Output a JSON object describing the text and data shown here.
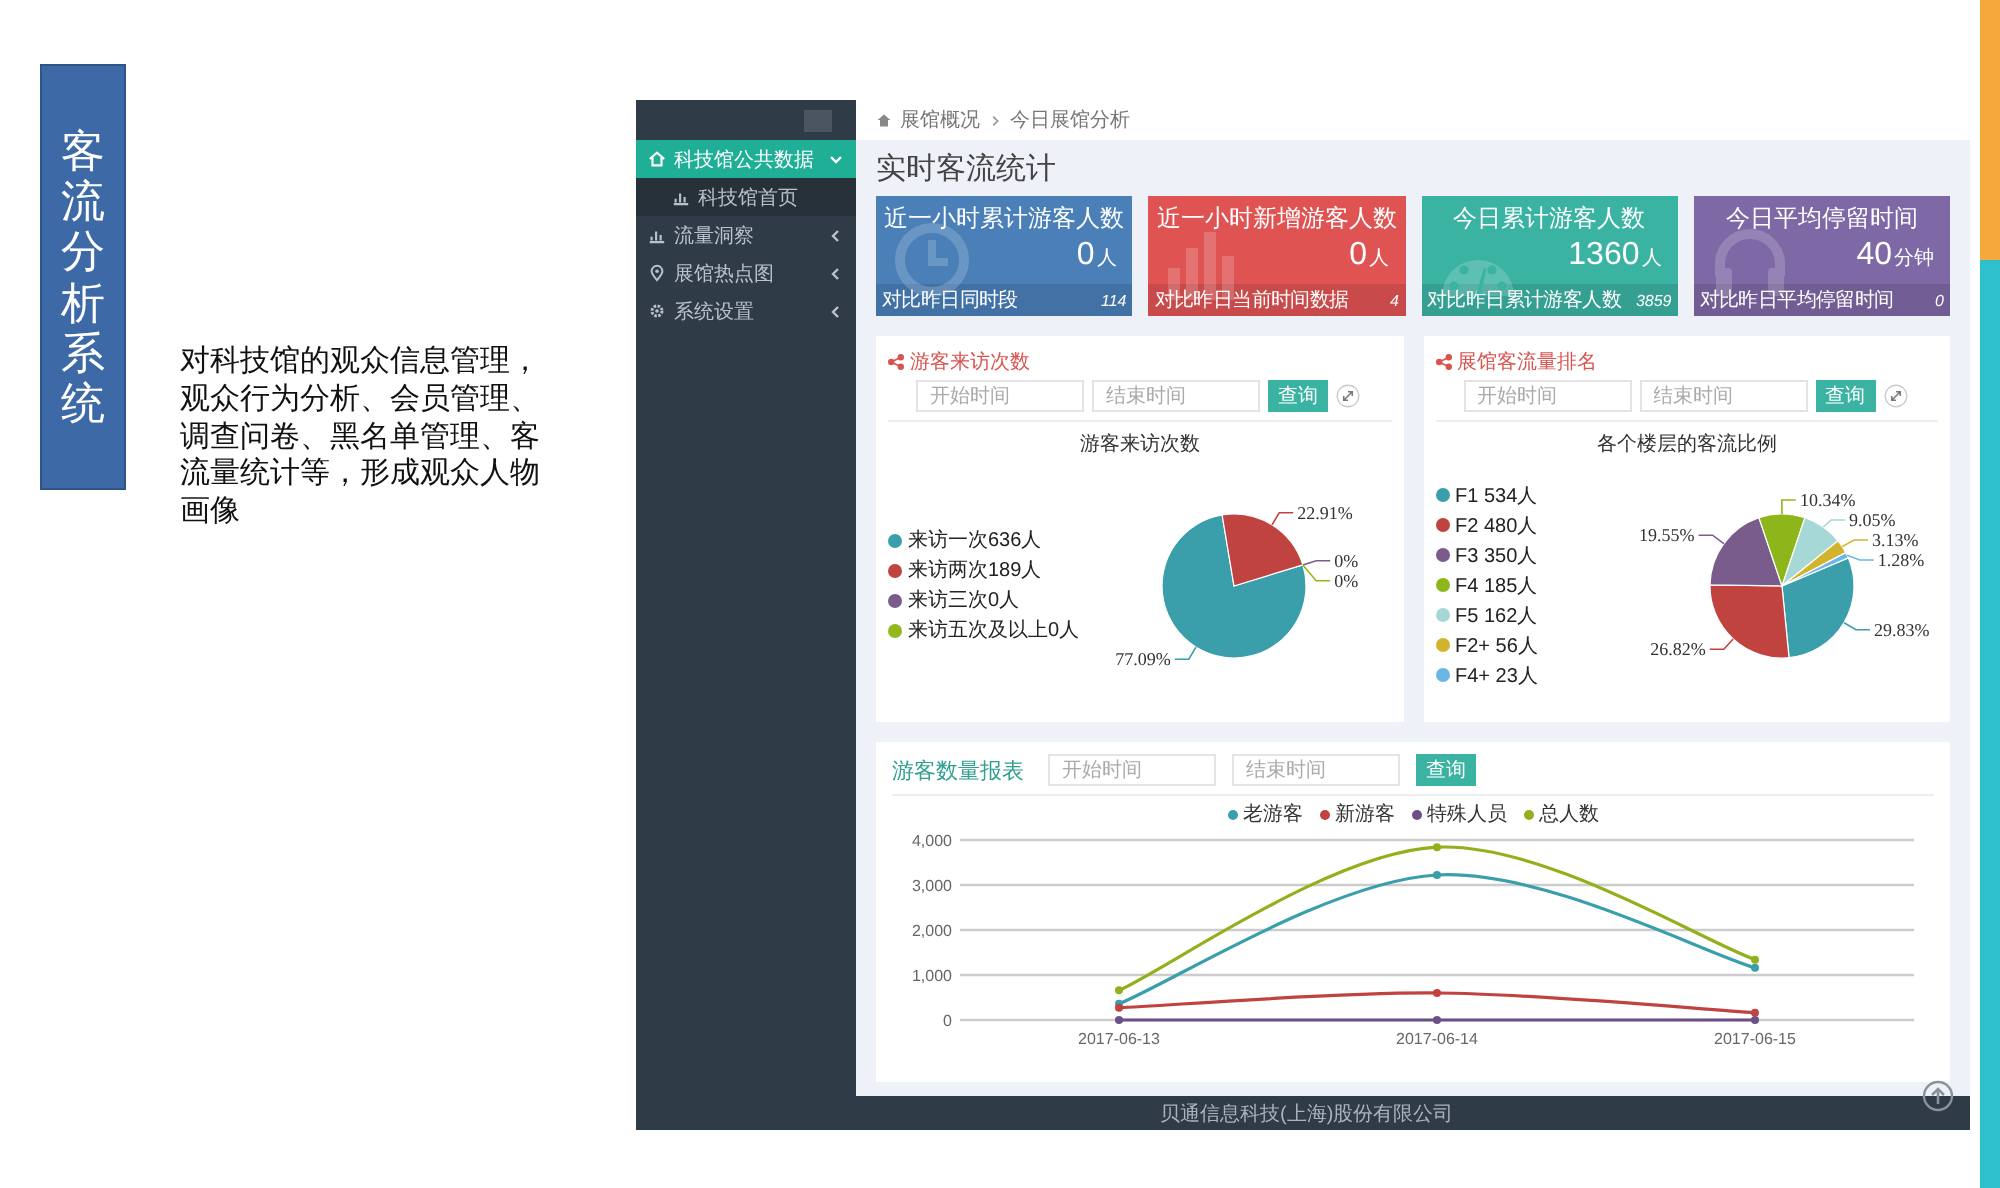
{
  "slide": {
    "title": "客流分析系统",
    "description": "对科技馆的观众信息管理，观众行为分析、会员管理、调查问卷、黑名单管理、客流量统计等，形成观众人物画像"
  },
  "sidebar": {
    "items": [
      {
        "label": "科技馆公共数据",
        "selected": true,
        "expanded": true,
        "children": [
          {
            "label": "科技馆首页",
            "selected": false
          }
        ]
      },
      {
        "label": "流量洞察",
        "selected": false,
        "expanded": false
      },
      {
        "label": "展馆热点图",
        "selected": false,
        "expanded": false
      },
      {
        "label": "系统设置",
        "selected": false,
        "expanded": false
      }
    ]
  },
  "breadcrumb": [
    "展馆概况",
    "今日展馆分析"
  ],
  "page_title": "实时客流统计",
  "stat_cards": [
    {
      "title": "近一小时累计游客人数",
      "value": "0",
      "unit": "人",
      "compare_label": "对比昨日同时段",
      "compare_value": "114",
      "color": "#4a7fb8"
    },
    {
      "title": "近一小时新增游客人数",
      "value": "0",
      "unit": "人",
      "compare_label": "对比昨日当前时间数据",
      "compare_value": "4",
      "color": "#e05353"
    },
    {
      "title": "今日累计游客人数",
      "value": "1360",
      "unit": "人",
      "compare_label": "对比昨日累计游客人数",
      "compare_value": "3859",
      "color": "#3bb3a3"
    },
    {
      "title": "今日平均停留时间",
      "value": "40",
      "unit": "分钟",
      "compare_label": "对比昨日平均停留时间",
      "compare_value": "0",
      "color": "#7e68a5"
    }
  ],
  "panels": [
    {
      "title": "游客来访次数",
      "start_placeholder": "开始时间",
      "end_placeholder": "结束时间",
      "button": "查询",
      "legend": [
        {
          "label": "来访一次636人",
          "color": "#3a9eab"
        },
        {
          "label": "来访两次189人",
          "color": "#c0433f"
        },
        {
          "label": "来访三次0人",
          "color": "#7a5c8c"
        },
        {
          "label": "来访五次及以上0人",
          "color": "#92b81c"
        }
      ],
      "chart_data": {
        "type": "pie",
        "title": "游客来访次数",
        "values": [
          77.09,
          22.91,
          0,
          0
        ],
        "value_labels": [
          "77.09%",
          "22.91%",
          "0%",
          "0%"
        ]
      }
    },
    {
      "title": "展馆客流量排名",
      "start_placeholder": "开始时间",
      "end_placeholder": "结束时间",
      "button": "查询",
      "legend": [
        {
          "label": "F1 534人",
          "color": "#3a9eab"
        },
        {
          "label": "F2 480人",
          "color": "#c0433f"
        },
        {
          "label": "F3 350人",
          "color": "#7a5c8c"
        },
        {
          "label": "F4 185人",
          "color": "#8db61a"
        },
        {
          "label": "F5 162人",
          "color": "#a6d8d6"
        },
        {
          "label": "F2+ 56人",
          "color": "#d2b42c"
        },
        {
          "label": "F4+ 23人",
          "color": "#6ab7e6"
        }
      ],
      "chart_data": {
        "type": "pie",
        "title": "各个楼层的客流比例",
        "values": [
          29.83,
          26.82,
          19.55,
          10.34,
          9.05,
          3.13,
          1.28
        ],
        "value_labels": [
          "29.83%",
          "26.82%",
          "19.55%",
          "10.34%",
          "9.05%",
          "3.13%",
          "1.28%"
        ]
      }
    }
  ],
  "report": {
    "title": "游客数量报表",
    "start_placeholder": "开始时间",
    "end_placeholder": "结束时间",
    "button": "查询",
    "chart_data": {
      "type": "line",
      "categories": [
        "2017-06-13",
        "2017-06-14",
        "2017-06-15"
      ],
      "series": [
        {
          "name": "老游客",
          "color": "#3a9eab",
          "marker": true,
          "values": [
            360,
            3220,
            1160
          ]
        },
        {
          "name": "新游客",
          "color": "#c0433f",
          "marker": true,
          "values": [
            270,
            600,
            160
          ]
        },
        {
          "name": "特殊人员",
          "color": "#6b4f86",
          "marker": true,
          "values": [
            0,
            0,
            0
          ]
        },
        {
          "name": "总人数",
          "color": "#92b01c",
          "marker": true,
          "values": [
            660,
            3840,
            1340
          ]
        }
      ],
      "grid": true,
      "ylim": [
        0,
        4000
      ],
      "yticks": [
        {
          "value": 0,
          "label": "0"
        },
        {
          "value": 1000,
          "label": "1,000"
        },
        {
          "value": 2000,
          "label": "2,000"
        },
        {
          "value": 3000,
          "label": "3,000"
        },
        {
          "value": 4000,
          "label": "4,000"
        }
      ]
    }
  },
  "footer": {
    "text": "贝通信息科技(上海)股份有限公司"
  }
}
